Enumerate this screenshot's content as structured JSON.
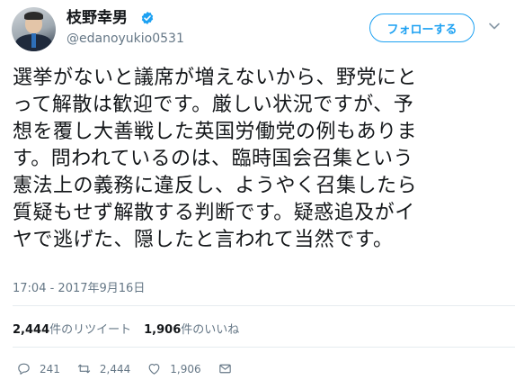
{
  "user": {
    "display_name": "枝野幸男",
    "handle": "@edanoyukio0531",
    "verified": true
  },
  "follow_button": {
    "label": "フォローする"
  },
  "tweet": {
    "lines": [
      "選挙がないと議席が増えないから、野党にと",
      "って解散は歓迎です。厳しい状況ですが、予",
      "想を覆し大善戦した英国労働党の例もありま",
      "す。問われているのは、臨時国会召集という",
      "憲法上の義務に違反し、ようやく召集したら",
      "質疑もせず解散する判断です。疑惑追及がイ",
      "ヤで逃げた、隠したと言われて当然です。"
    ],
    "timestamp": "17:04 - 2017年9月16日"
  },
  "stats": {
    "retweets_count": "2,444",
    "retweets_label": "件のリツイート",
    "likes_count": "1,906",
    "likes_label": "件のいいね"
  },
  "actions": {
    "reply_count": "241",
    "retweet_count": "2,444",
    "like_count": "1,906"
  },
  "colors": {
    "accent": "#1da1f2",
    "secondary_text": "#657786",
    "primary_text": "#14171a",
    "divider": "#e6ecf0"
  },
  "icons": [
    "verified-badge-icon",
    "chevron-down-icon",
    "reply-icon",
    "retweet-icon",
    "like-icon",
    "direct-message-icon"
  ]
}
